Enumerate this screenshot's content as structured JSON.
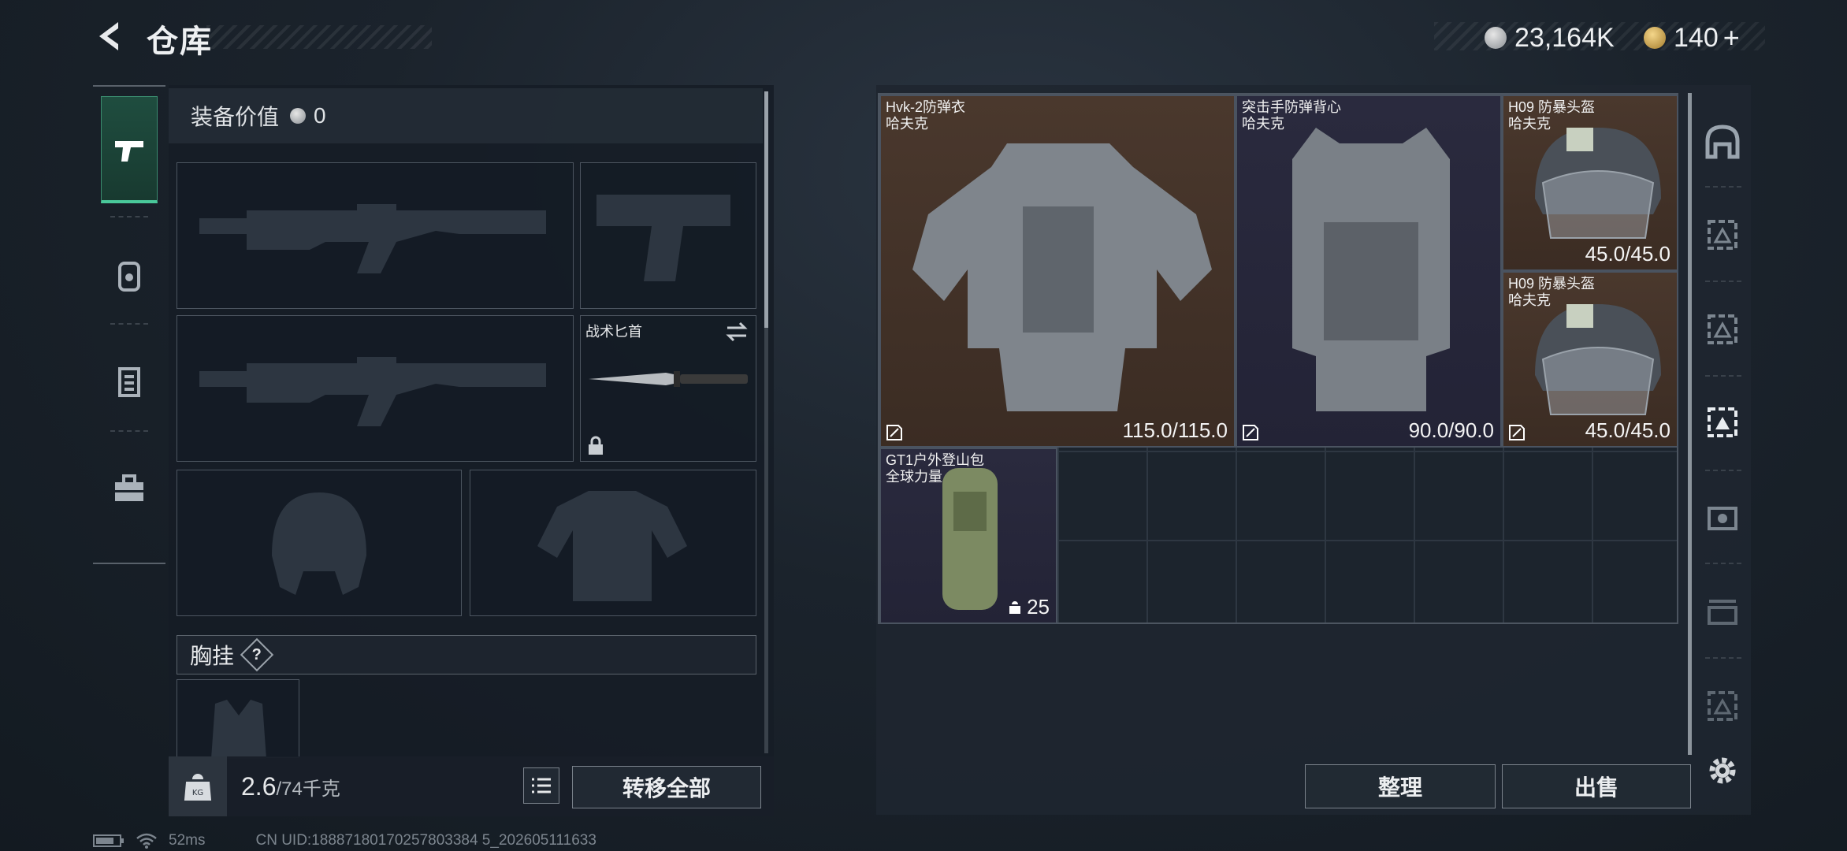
{
  "header": {
    "title": "仓库",
    "silver": "23,164K",
    "gold": "140",
    "gold_add": "+"
  },
  "left_tabs": [
    "pistol-icon",
    "backpack-icon",
    "vest-icon",
    "toolbox-icon"
  ],
  "equipment": {
    "value_label": "装备价值",
    "value": "0",
    "knife_label": "战术匕首",
    "chest_label": "胸挂",
    "chest_help": "?",
    "weight_current": "2.6",
    "weight_max": "/74千克",
    "transfer_all": "转移全部"
  },
  "items": [
    {
      "name": "Hvk-2防弹衣",
      "brand": "哈夫克",
      "durability": "115.0/115.0"
    },
    {
      "name": "突击手防弹背心",
      "brand": "哈夫克",
      "durability": "90.0/90.0"
    },
    {
      "name": "H09 防暴头盔",
      "brand": "哈夫克",
      "durability": "45.0/45.0"
    },
    {
      "name": "H09 防暴头盔",
      "brand": "哈夫克",
      "durability": "45.0/45.0"
    },
    {
      "name": "GT1户外登山包",
      "brand": "全球力量",
      "capacity": "25"
    }
  ],
  "actions": {
    "sort": "整理",
    "sell": "出售"
  },
  "right_tabs": [
    "helmet-filter-icon",
    "armor-filter-1-icon",
    "armor-filter-2-icon",
    "armor-filter-3-icon",
    "armor-filter-4-icon",
    "armor-filter-5-icon",
    "armor-filter-6-icon"
  ],
  "status": {
    "ping": "52ms",
    "uid": "CN UID:18887180170257803384 5_202605111633"
  },
  "colors": {
    "accent_green": "#49c89a",
    "rarity_brown": "#4a382d",
    "rarity_purple": "#2a2a3e"
  }
}
